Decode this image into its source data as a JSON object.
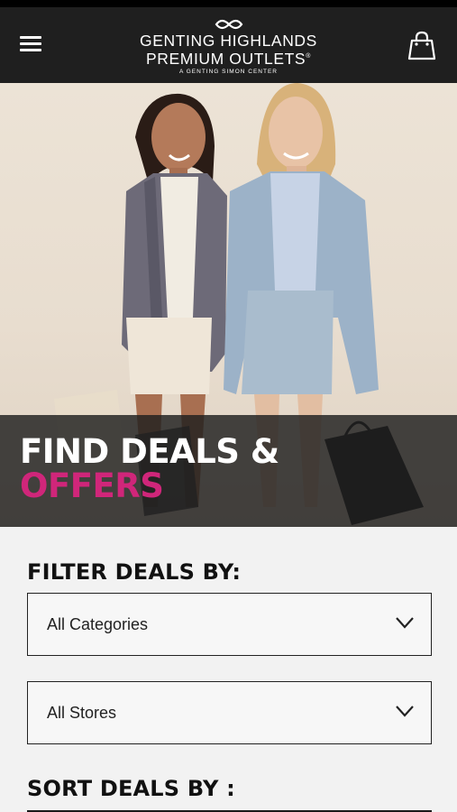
{
  "header": {
    "logo_line1": "GENTING HIGHLANDS",
    "logo_line2": "PREMIUM OUTLETS",
    "logo_registered": "®",
    "logo_subtitle": "A GENTING SIMON CENTER",
    "menu_icon": "hamburger-menu-icon",
    "bag_icon": "shopping-bag-icon"
  },
  "hero": {
    "title_line1": "FIND DEALS &",
    "title_line2": "OFFERS",
    "accent_color": "#d0267a"
  },
  "filters": {
    "title": "FILTER DEALS BY:",
    "category_select": {
      "selected": "All Categories"
    },
    "store_select": {
      "selected": "All Stores"
    }
  },
  "sort": {
    "title": "SORT DEALS BY :"
  }
}
